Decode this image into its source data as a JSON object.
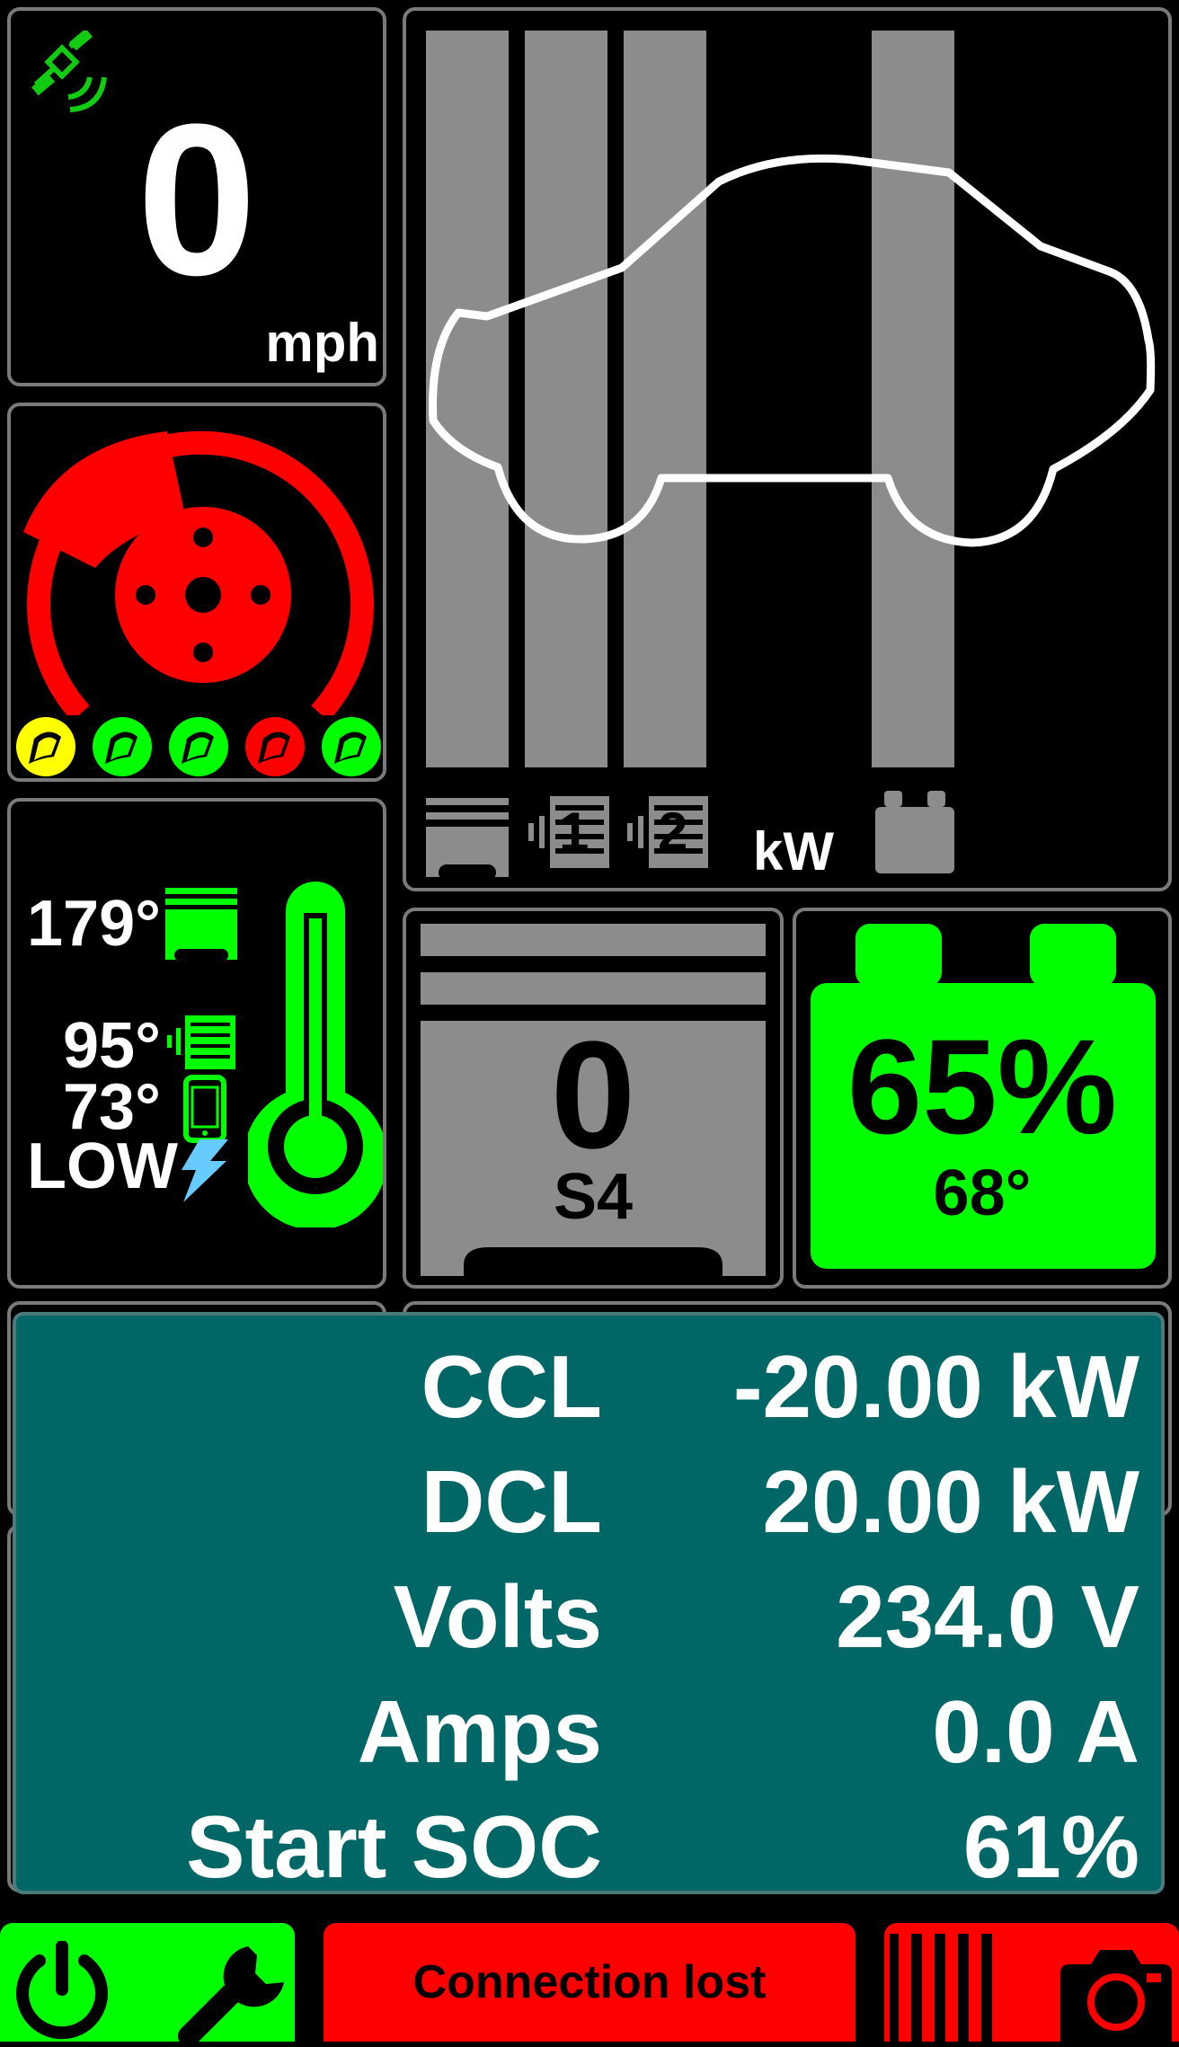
{
  "speed": {
    "value": "0",
    "unit": "mph",
    "gps_icon": "satellite-icon",
    "color": "#ffffff"
  },
  "brake": {
    "icon": "brake-disc-icon",
    "color": "#ff0000",
    "pads": [
      {
        "name": "pad-1",
        "status_color": "#ffff00"
      },
      {
        "name": "pad-2",
        "status_color": "#00ff00"
      },
      {
        "name": "pad-3",
        "status_color": "#00ff00"
      },
      {
        "name": "pad-4",
        "status_color": "#ff0000"
      },
      {
        "name": "pad-5",
        "status_color": "#00ff00"
      }
    ]
  },
  "power": {
    "unit": "kW",
    "bars": [
      {
        "name": "motor-power-bar",
        "icon": "motor-icon"
      },
      {
        "name": "inverter-1-power-bar",
        "icon": "inverter-1-icon",
        "label": "1"
      },
      {
        "name": "inverter-2-power-bar",
        "icon": "inverter-2-icon",
        "label": "2"
      },
      {
        "name": "battery-power-bar",
        "icon": "battery-icon"
      }
    ],
    "car_icon": "car-outline-icon"
  },
  "temps": {
    "motor": "179°",
    "inverter": "95°",
    "phone": "73°",
    "charger": "LOW",
    "accent": "#00ff00"
  },
  "gear": {
    "value": "0",
    "mode": "S4",
    "color": "#8c8c8c"
  },
  "battery": {
    "soc": "65%",
    "temp": "68°",
    "color": "#00ff00"
  },
  "stats": [
    {
      "label": "CCL",
      "value": "-20.00 kW"
    },
    {
      "label": "DCL",
      "value": "20.00 kW"
    },
    {
      "label": "Volts",
      "value": "234.0 V"
    },
    {
      "label": "Amps",
      "value": "0.0 A"
    },
    {
      "label": "Start SOC",
      "value": "61%"
    }
  ],
  "stats_bg": "#006666",
  "footer": {
    "status": "Connection lost",
    "status_color": "#ff0000",
    "power_icon": "power-icon",
    "wrench_icon": "wrench-icon",
    "barcode_icon": "barcode-icon",
    "camera_icon": "camera-icon"
  }
}
